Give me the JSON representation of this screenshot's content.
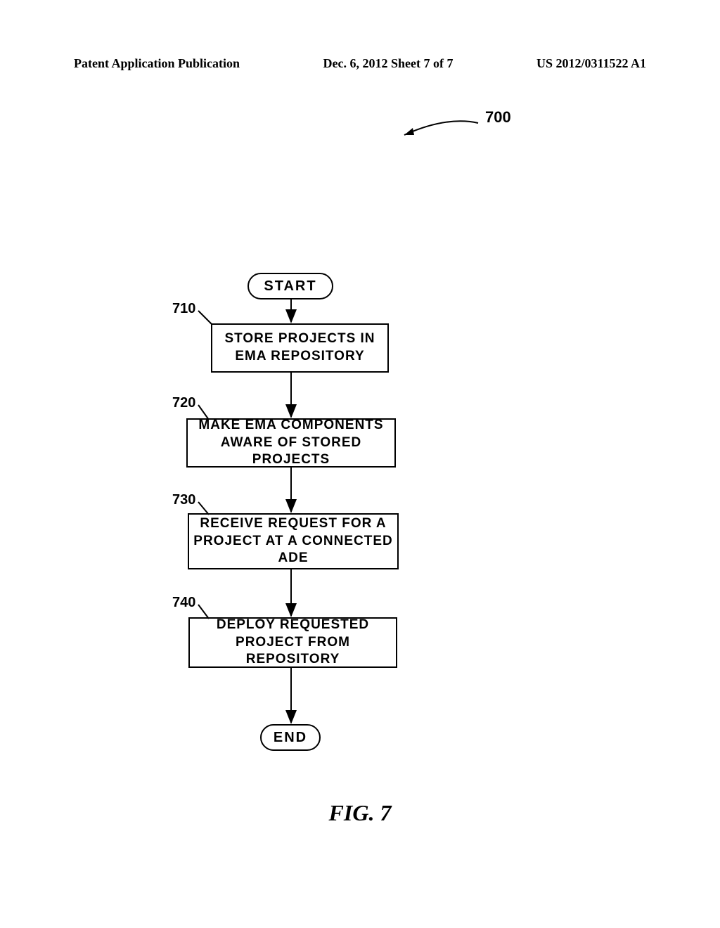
{
  "header": {
    "left": "Patent Application Publication",
    "center": "Dec. 6, 2012  Sheet 7 of 7",
    "right": "US 2012/0311522 A1"
  },
  "reference": {
    "overall": "700",
    "r710": "710",
    "r720": "720",
    "r730": "730",
    "r740": "740"
  },
  "flowchart": {
    "start": "START",
    "end": "END",
    "step710": "STORE PROJECTS IN EMA REPOSITORY",
    "step720": "MAKE EMA COMPONENTS AWARE OF STORED PROJECTS",
    "step730": "RECEIVE REQUEST FOR A PROJECT AT A CONNECTED ADE",
    "step740": "DEPLOY REQUESTED PROJECT FROM REPOSITORY"
  },
  "caption": "FIG. 7"
}
